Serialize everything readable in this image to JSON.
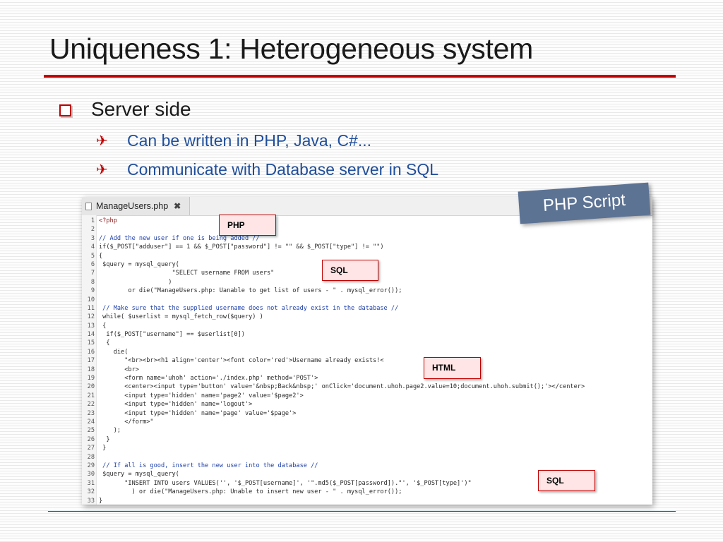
{
  "slide": {
    "title": "Uniqueness 1: Heterogeneous system",
    "bullet": "Server side",
    "sub_bullets": [
      "Can be written in PHP, Java, C#...",
      "Communicate with Database server in SQL"
    ],
    "sub_bullet_glyph": "✈",
    "colors": {
      "accent": "#c00000",
      "sub_text": "#1f4e9a",
      "callout_bg": "#5c7394"
    }
  },
  "editor": {
    "tab_label": "ManageUsers.php",
    "close_glyph": "✖",
    "lines": [
      {
        "n": "1",
        "t": "<?php",
        "c": "kw"
      },
      {
        "n": "2",
        "t": "",
        "c": ""
      },
      {
        "n": "3",
        "t": "// Add the new user if one is being added //",
        "c": "cmt"
      },
      {
        "n": "4",
        "t": "if($_POST[\"adduser\"] == 1 && $_POST[\"password\"] != \"\" && $_POST[\"type\"] != \"\")",
        "c": ""
      },
      {
        "n": "5",
        "t": "{",
        "c": ""
      },
      {
        "n": "6",
        "t": " $query = mysql_query(",
        "c": ""
      },
      {
        "n": "7",
        "t": "                    \"SELECT username FROM users\"",
        "c": ""
      },
      {
        "n": "8",
        "t": "                   )",
        "c": ""
      },
      {
        "n": "9",
        "t": "        or die(\"ManageUsers.php: Uanable to get list of users - \" . mysql_error());",
        "c": ""
      },
      {
        "n": "10",
        "t": "",
        "c": ""
      },
      {
        "n": "11",
        "t": " // Make sure that the supplied username does not already exist in the database //",
        "c": "cmt"
      },
      {
        "n": "12",
        "t": " while( $userlist = mysql_fetch_row($query) )",
        "c": ""
      },
      {
        "n": "13",
        "t": " {",
        "c": ""
      },
      {
        "n": "14",
        "t": "  if($_POST[\"username\"] == $userlist[0])",
        "c": ""
      },
      {
        "n": "15",
        "t": "  {",
        "c": ""
      },
      {
        "n": "16",
        "t": "    die(",
        "c": ""
      },
      {
        "n": "17",
        "t": "       \"<br><br><h1 align='center'><font color='red'>Username already exists!<",
        "c": ""
      },
      {
        "n": "18",
        "t": "       <br>",
        "c": ""
      },
      {
        "n": "19",
        "t": "       <form name='uhoh' action='./index.php' method='POST'>",
        "c": ""
      },
      {
        "n": "20",
        "t": "       <center><input type='button' value='&nbsp;Back&nbsp;' onClick='document.uhoh.page2.value=10;document.uhoh.submit();'></center>",
        "c": ""
      },
      {
        "n": "21",
        "t": "       <input type='hidden' name='page2' value='$page2'>",
        "c": ""
      },
      {
        "n": "22",
        "t": "       <input type='hidden' name='logout'>",
        "c": ""
      },
      {
        "n": "23",
        "t": "       <input type='hidden' name='page' value='$page'>",
        "c": ""
      },
      {
        "n": "24",
        "t": "       </form>\"",
        "c": ""
      },
      {
        "n": "25",
        "t": "    );",
        "c": ""
      },
      {
        "n": "26",
        "t": "  }",
        "c": ""
      },
      {
        "n": "27",
        "t": " }",
        "c": ""
      },
      {
        "n": "28",
        "t": "",
        "c": ""
      },
      {
        "n": "29",
        "t": " // If all is good, insert the new user into the database //",
        "c": "cmt"
      },
      {
        "n": "30",
        "t": " $query = mysql_query(",
        "c": ""
      },
      {
        "n": "31",
        "t": "       \"INSERT INTO users VALUES('', '$_POST[username]', '\".md5($_POST[password]).\"', '$_POST[type]')\"",
        "c": ""
      },
      {
        "n": "32",
        "t": "         ) or die(\"ManageUsers.php: Unable to insert new user - \" . mysql_error());",
        "c": ""
      },
      {
        "n": "33",
        "t": "}",
        "c": ""
      }
    ]
  },
  "annotations": {
    "php": "PHP",
    "sql_1": "SQL",
    "html": "HTML",
    "sql_2": "SQL",
    "callout": "PHP Script"
  }
}
